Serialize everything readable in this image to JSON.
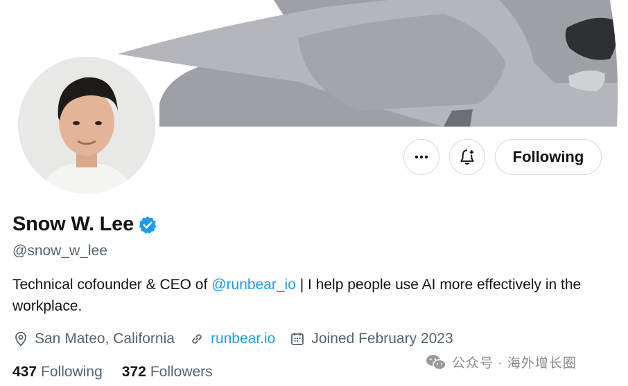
{
  "profile": {
    "name": "Snow W. Lee",
    "handle": "@snow_w_lee",
    "bio_before": "Technical cofounder & CEO of ",
    "bio_mention": "@runbear_io",
    "bio_after": " | I help people use AI more effectively in the workplace.",
    "location": "San Mateo, California",
    "website": "runbear.io",
    "joined": "Joined February 2023",
    "following_count": "437",
    "following_label": "Following",
    "followers_count": "372",
    "followers_label": "Followers"
  },
  "actions": {
    "follow_state_label": "Following"
  },
  "watermark": {
    "text": "公众号 · 海外增长圈"
  },
  "colors": {
    "accent": "#1d9bf0",
    "secondary_text": "#536471",
    "border": "#cfd9de"
  },
  "icons": {
    "more": "more-dots-icon",
    "bell": "bell-plus-icon",
    "verified": "verified-badge-icon",
    "location": "location-pin-icon",
    "link": "link-icon",
    "calendar": "calendar-icon"
  }
}
